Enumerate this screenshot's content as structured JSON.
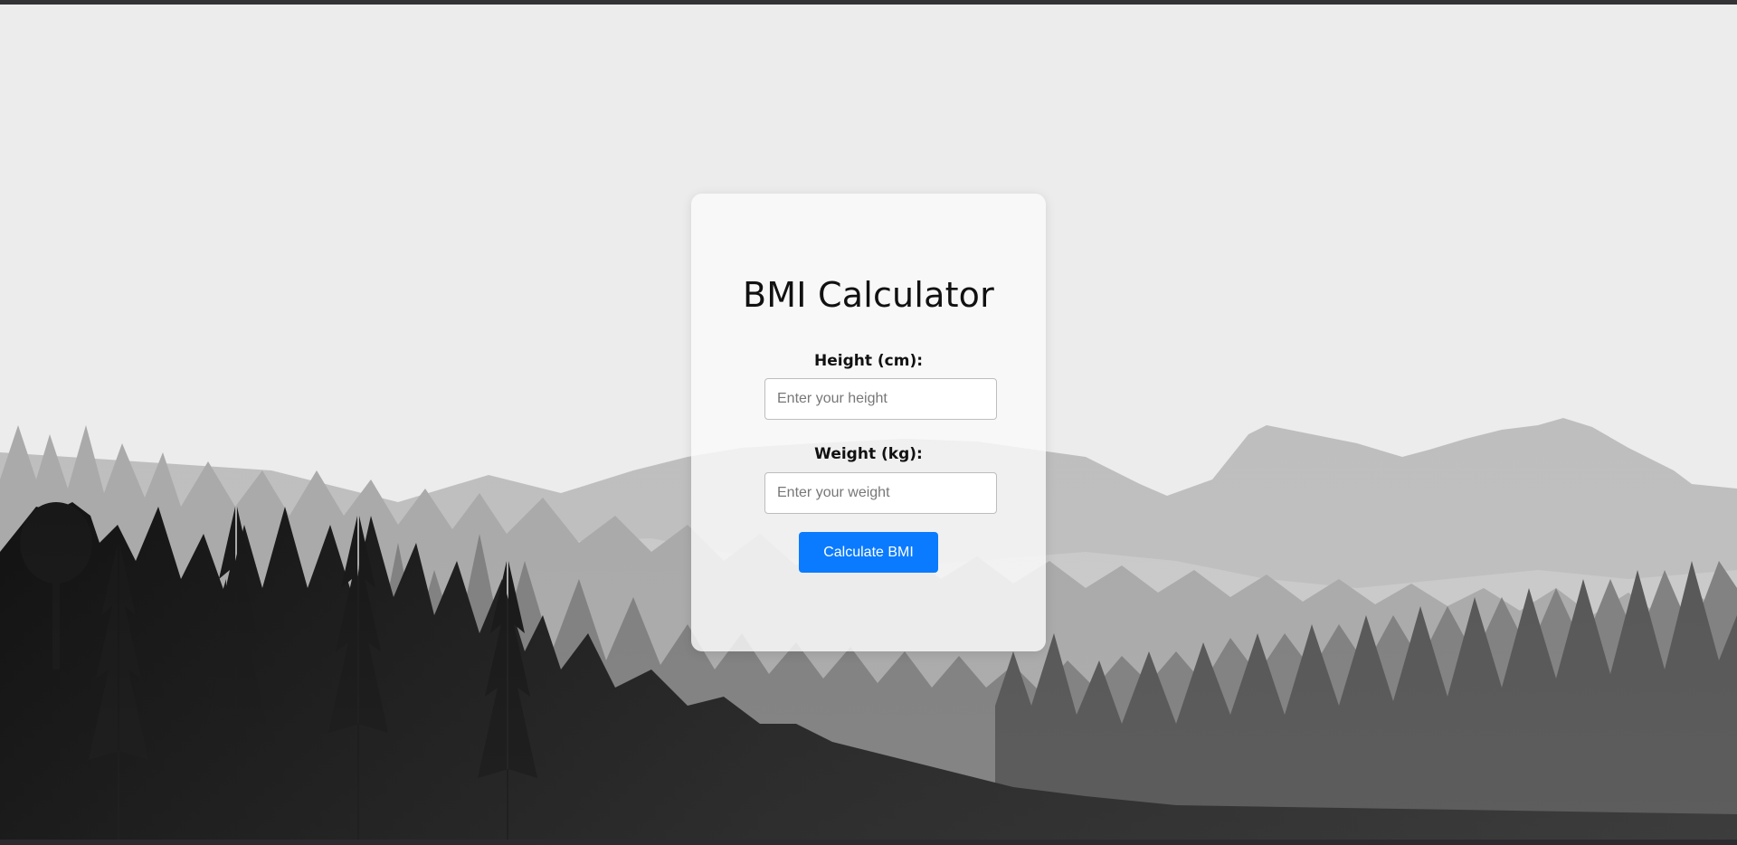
{
  "app": {
    "title": "BMI Calculator"
  },
  "form": {
    "height_label": "Height (cm):",
    "height_placeholder": "Enter your height",
    "height_value": "",
    "weight_label": "Weight (kg):",
    "weight_placeholder": "Enter your weight",
    "weight_value": "",
    "submit_label": "Calculate BMI"
  },
  "colors": {
    "background": "#ececec",
    "accent": "#0a7bff",
    "card": "#fafafa"
  }
}
